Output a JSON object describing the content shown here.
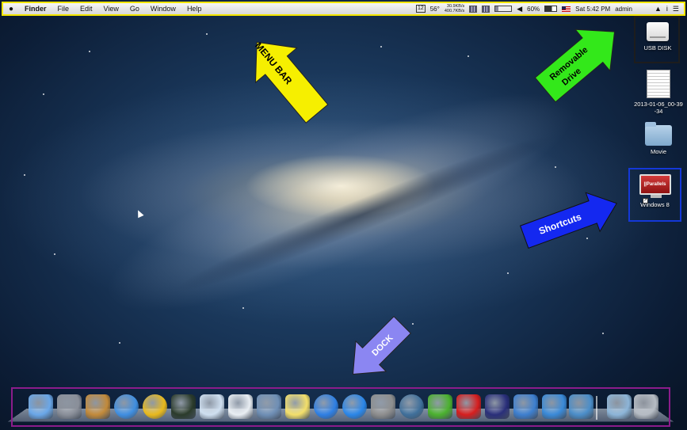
{
  "menubar": {
    "app_name": "Finder",
    "items": [
      "File",
      "Edit",
      "View",
      "Go",
      "Window",
      "Help"
    ],
    "calendar_badge": "12",
    "temperature": "56°",
    "net_up": "30.9KB/s",
    "net_down": "400.7KB/s",
    "battery_percent": "60%",
    "clock": "Sat 5:42 PM",
    "user": "admin"
  },
  "desktop_icons": {
    "usb_disk": "USB DISK",
    "screenshot": "2013-01-06_00-39-34",
    "movie_folder": "Movie",
    "windows8": "Windows 8",
    "parallels_logo": "||Parallels"
  },
  "annotations": {
    "menu_bar": "MENU BAR",
    "removable_drive": [
      "Removable",
      "Drive"
    ],
    "shortcuts": "Shortcuts",
    "dock": "DOCK"
  },
  "annotation_colors": {
    "menu_bar": "#f6ef00",
    "removable_drive": "#33e81a",
    "shortcuts": "#1428f0",
    "dock": "#8b86f2",
    "dock_frame": "#8b1c8b",
    "shortcut_frame": "#1438d8"
  },
  "dock": {
    "icons": [
      {
        "name": "finder-icon",
        "color": "#6aa7e8"
      },
      {
        "name": "launchpad-icon",
        "color": "#8a8f99"
      },
      {
        "name": "photo-slideshow-icon",
        "color": "#c28a3a"
      },
      {
        "name": "safari-icon",
        "color": "#3f8ee0"
      },
      {
        "name": "chrome-icon",
        "color": "#e8b91c"
      },
      {
        "name": "activity-monitor-icon",
        "color": "#2b3b2b"
      },
      {
        "name": "textedit-icon",
        "color": "#cfdff0"
      },
      {
        "name": "ical-icon",
        "color": "#e9eef3"
      },
      {
        "name": "preview-icon",
        "color": "#6f8fb5"
      },
      {
        "name": "stickies-icon",
        "color": "#f3df6a"
      },
      {
        "name": "itunes-icon",
        "color": "#2e7fe3"
      },
      {
        "name": "app-store-icon",
        "color": "#2a86e8"
      },
      {
        "name": "system-preferences-icon",
        "color": "#8e8e8e"
      },
      {
        "name": "camera-icon",
        "color": "#3f6f9a"
      },
      {
        "name": "adium-icon",
        "color": "#4bb12e"
      },
      {
        "name": "red-cross-app-icon",
        "color": "#d61e1e"
      },
      {
        "name": "video-player-icon",
        "color": "#2a2f7a"
      },
      {
        "name": "mail-bird-icon",
        "color": "#3d7fcf"
      },
      {
        "name": "writer-app-icon",
        "color": "#3a8ad8"
      },
      {
        "name": "xcode-icon",
        "color": "#4b8ec9"
      },
      {
        "name": "applications-folder-icon",
        "color": "#8db5d8"
      },
      {
        "name": "trash-icon",
        "color": "#b6bcc4"
      }
    ]
  }
}
